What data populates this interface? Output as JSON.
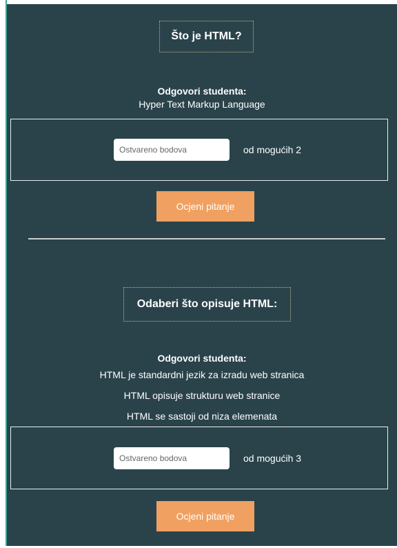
{
  "questions": [
    {
      "title": "Što je HTML?",
      "answers_label": "Odgovori studenta:",
      "answers": [
        "Hyper Text Markup Language"
      ],
      "points_placeholder": "Ostvareno bodova",
      "max_points_text": "od mogućih 2",
      "grade_button_label": "Ocjeni pitanje"
    },
    {
      "title": "Odaberi što opisuje HTML:",
      "answers_label": "Odgovori studenta:",
      "answers": [
        "HTML je standardni jezik za izradu web stranica",
        "HTML opisuje strukturu web stranice",
        "HTML se sastoji od niza elemenata"
      ],
      "points_placeholder": "Ostvareno bodova",
      "max_points_text": "od mogućih 3",
      "grade_button_label": "Ocjeni pitanje"
    }
  ],
  "colors": {
    "panel_background": "#2a434b",
    "accent_button": "#f0a060",
    "title_border": "#c8b88a",
    "left_accent_line": "#3aa79a"
  }
}
